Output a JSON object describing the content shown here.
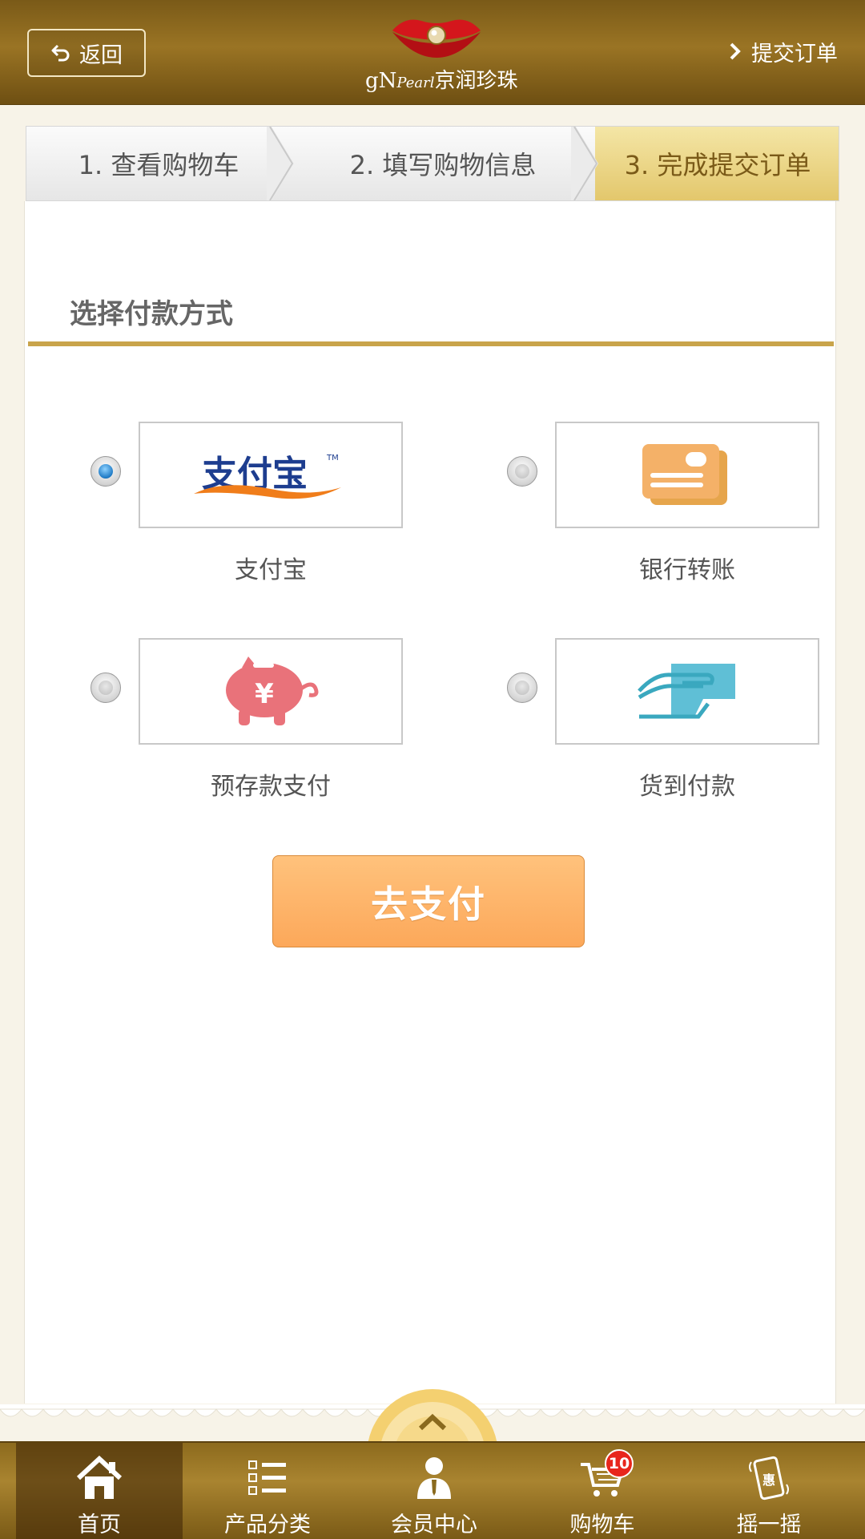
{
  "header": {
    "back_label": "返回",
    "logo_text_gn": "gN",
    "logo_text_pearl": "Pearl",
    "logo_text_cn": "京润珍珠",
    "submit_label": "提交订单"
  },
  "steps": [
    {
      "label": "1. 查看购物车",
      "active": false
    },
    {
      "label": "2. 填写购物信息",
      "active": false
    },
    {
      "label": "3. 完成提交订单",
      "active": true
    }
  ],
  "section": {
    "title": "选择付款方式"
  },
  "payment_options": [
    {
      "label": "支付宝",
      "logo_text": "支付宝",
      "icon": "alipay-logo",
      "selected": true
    },
    {
      "label": "银行转账",
      "icon": "bank-card-icon",
      "selected": false
    },
    {
      "label": "预存款支付",
      "icon": "piggy-bank-icon",
      "selected": false
    },
    {
      "label": "货到付款",
      "icon": "cash-on-delivery-icon",
      "selected": false
    }
  ],
  "pay_button": {
    "label": "去支付"
  },
  "tabbar": {
    "items": [
      {
        "label": "首页",
        "icon": "home-icon",
        "active": true
      },
      {
        "label": "产品分类",
        "icon": "list-icon",
        "active": false
      },
      {
        "label": "会员中心",
        "icon": "member-icon",
        "active": false
      },
      {
        "label": "购物车",
        "icon": "cart-icon",
        "badge": "10",
        "active": false
      },
      {
        "label": "摇一摇",
        "icon": "shake-phone-icon",
        "icon_text": "惠",
        "active": false
      }
    ]
  },
  "colors": {
    "header_gold": "#8a6a1e",
    "accent_rule": "#c9a44b",
    "pay_button": "#fcb264",
    "active_step": "#e9d07e",
    "badge_red": "#e8261c"
  }
}
